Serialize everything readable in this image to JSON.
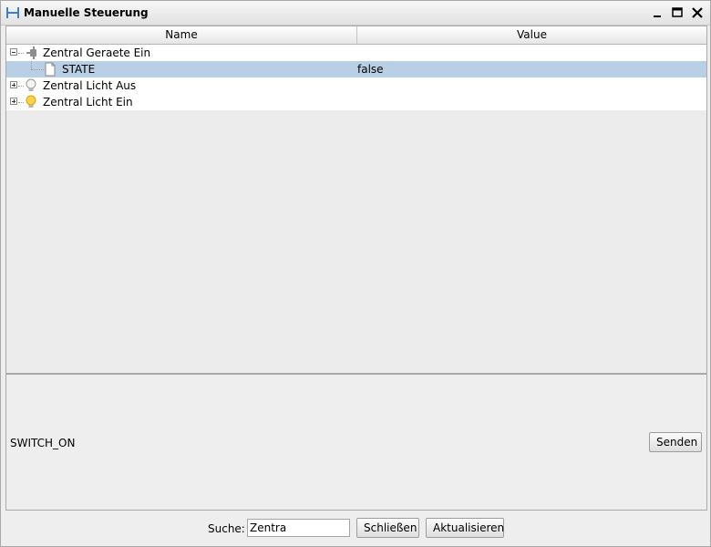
{
  "window": {
    "title": "Manuelle Steuerung",
    "accent": "#b8cfe5"
  },
  "table": {
    "columns": [
      "Name",
      "Value"
    ],
    "rows": [
      {
        "name": "Zentral Geraete Ein",
        "value": "",
        "icon": "plug-icon",
        "expanded": true
      },
      {
        "name": "STATE",
        "value": "false",
        "icon": "document-icon",
        "selected": true
      },
      {
        "name": "Zentral Licht Aus",
        "value": "",
        "icon": "light-bulb-off-icon",
        "expanded": false
      },
      {
        "name": "Zentral Licht Ein",
        "value": "",
        "icon": "light-bulb-on-icon",
        "expanded": false
      }
    ]
  },
  "detail": {
    "command": "SWITCH_ON",
    "send_label": "Senden"
  },
  "footer": {
    "search_label": "Suche:",
    "search_value": "Zentra",
    "close_label": "Schließen",
    "refresh_label": "Aktualisieren"
  }
}
